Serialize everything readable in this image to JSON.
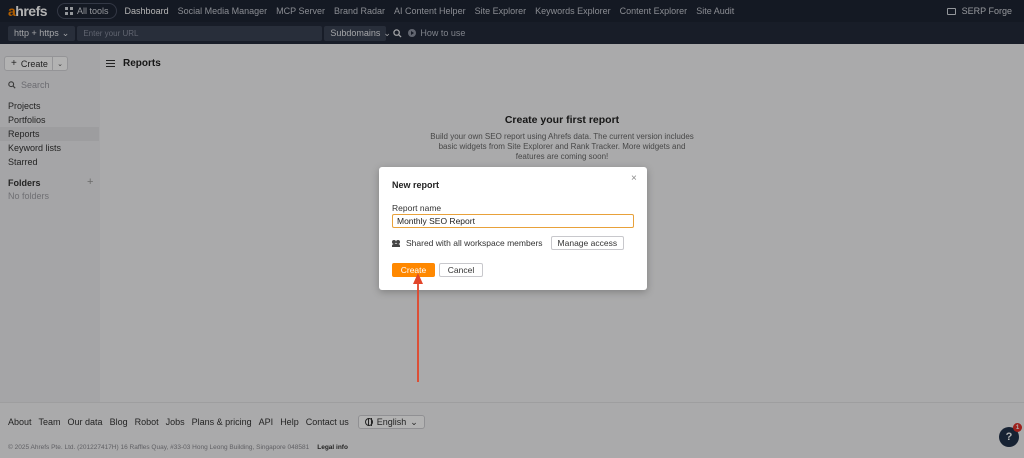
{
  "topnav": {
    "logo_a": "a",
    "logo_rest": "hrefs",
    "all_tools": "All tools",
    "links": [
      "Dashboard",
      "Social Media Manager",
      "MCP Server",
      "Brand Radar",
      "AI Content Helper",
      "Site Explorer",
      "Keywords Explorer",
      "Content Explorer",
      "Site Audit"
    ],
    "workspace": "SERP Forge"
  },
  "urlbar": {
    "protocol": "http + https",
    "url_placeholder": "Enter your URL",
    "subdomains": "Subdomains",
    "how_to_use": "How to use"
  },
  "sidebar": {
    "create_label": "Create",
    "search_placeholder": "Search",
    "items": [
      "Projects",
      "Portfolios",
      "Reports",
      "Keyword lists",
      "Starred"
    ],
    "folders_heading": "Folders",
    "no_folders": "No folders"
  },
  "main": {
    "title": "Reports",
    "empty_title": "Create your first report",
    "empty_desc": "Build your own SEO report using Ahrefs data. The current version includes basic widgets from Site Explorer and Rank Tracker. More widgets and features are coming soon!"
  },
  "modal": {
    "title": "New report",
    "close": "×",
    "field_label": "Report name",
    "report_name": "Monthly SEO Report",
    "shared_text": "Shared with all workspace members",
    "manage_access": "Manage access",
    "create": "Create",
    "cancel": "Cancel"
  },
  "footer": {
    "links": [
      "About",
      "Team",
      "Our data",
      "Blog",
      "Robot",
      "Jobs",
      "Plans & pricing",
      "API",
      "Help",
      "Contact us"
    ],
    "language": "English",
    "copyright": "© 2025 Ahrefs Pte. Ltd. (201227417H) 16 Raffles Quay, #33-03 Hong Leong Building, Singapore 048581",
    "legal": "Legal info",
    "help": "?",
    "help_badge": "1"
  },
  "colors": {
    "nav_bg": "#1e2433",
    "brand_orange": "#ff8800",
    "arrow_red": "#e2452a"
  }
}
